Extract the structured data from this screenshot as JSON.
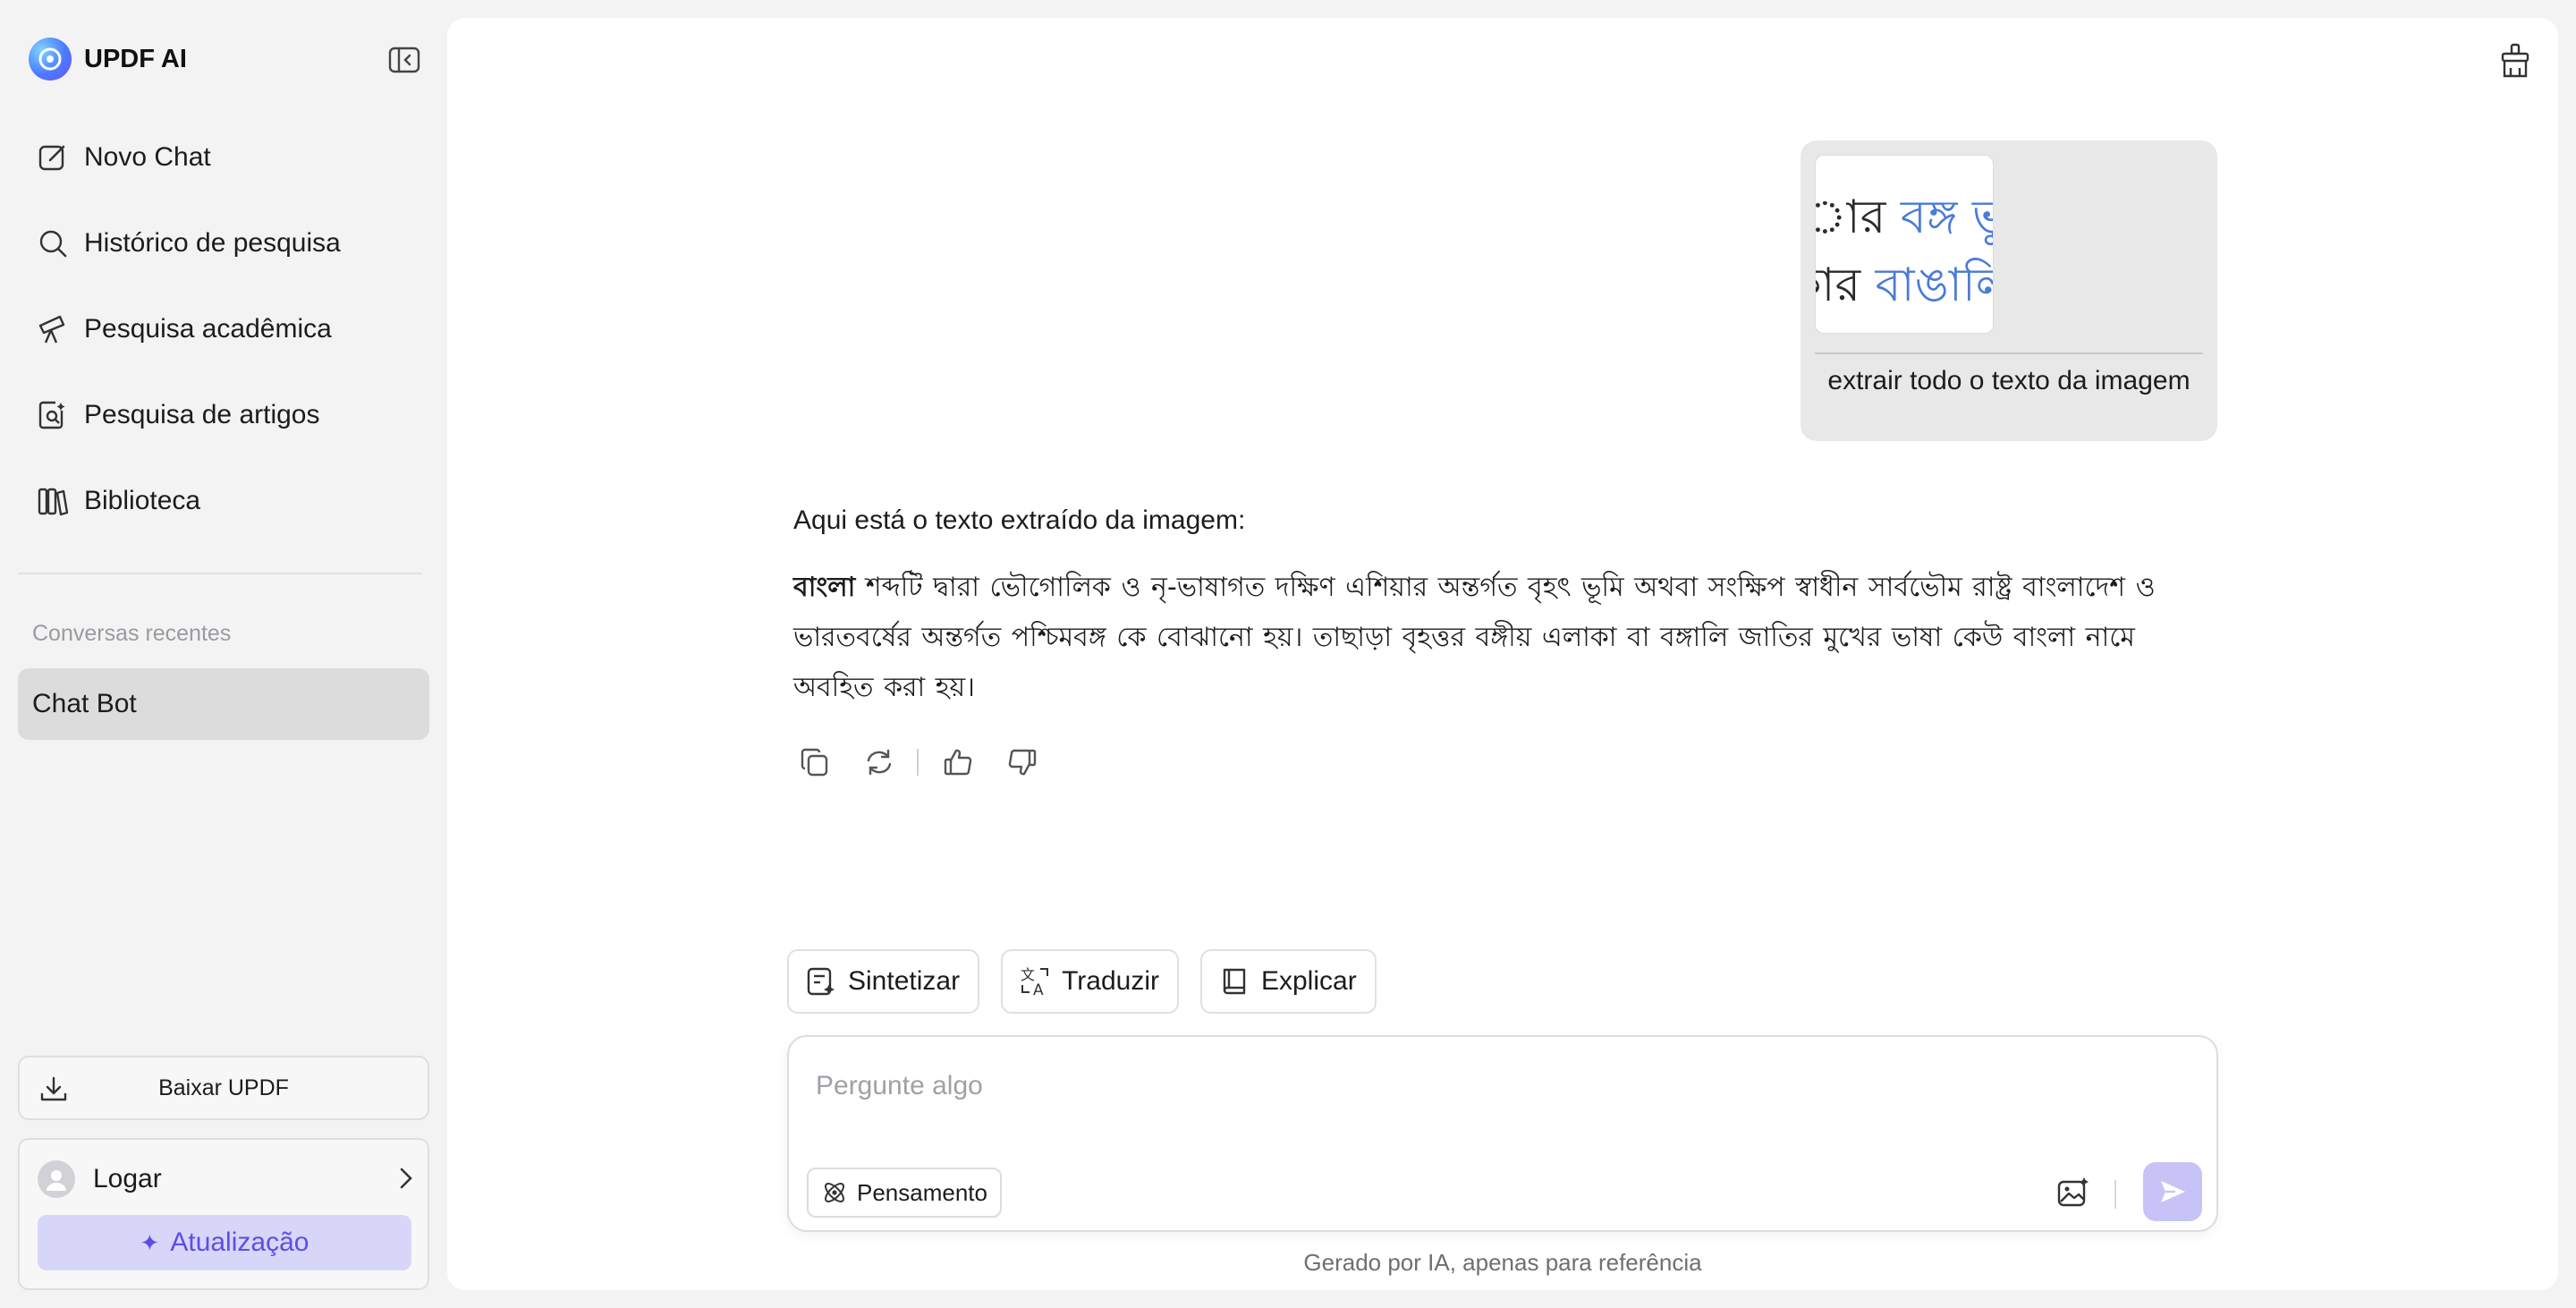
{
  "brand": {
    "name": "UPDF AI",
    "logo_icon": "updf-logo-icon"
  },
  "sidebar": {
    "collapse_icon": "sidebar-collapse-icon",
    "items": [
      {
        "label": "Novo Chat",
        "icon": "edit-icon"
      },
      {
        "label": "Histórico de pesquisa",
        "icon": "search-icon"
      },
      {
        "label": "Pesquisa acadêmica",
        "icon": "telescope-icon"
      },
      {
        "label": "Pesquisa de artigos",
        "icon": "doc-search-icon"
      },
      {
        "label": "Biblioteca",
        "icon": "library-icon"
      }
    ],
    "recent_title": "Conversas recentes",
    "recent_items": [
      {
        "label": "Chat Bot",
        "active": true
      }
    ],
    "download_label": "Baixar UPDF",
    "login_label": "Logar",
    "upgrade_label": "Atualização"
  },
  "chat": {
    "user_message": {
      "image_text_line1_a": "ার ",
      "image_text_line1_b": "বঙ্গ ভূমি",
      "image_text_line2_a": "কার ",
      "image_text_line2_b": "বাঙালি",
      "text": "extrair todo o texto da imagem"
    },
    "answer": {
      "intro": "Aqui está o texto extraído da imagem:",
      "bold_word": "বাংলা",
      "body": " শব্দটি দ্বারা ভৌগোলিক ও নৃ-ভাষাগত দক্ষিণ এশিয়ার অন্তর্গত বৃহৎ ভূমি অথবা সংক্ষিপ স্বাধীন সার্বভৌম রাষ্ট্র বাংলাদেশ ও ভারতবর্ষের অন্তর্গত পশ্চিমবঙ্গ কে বোঝানো হয়। তাছাড়া বৃহত্তর বঙ্গীয় এলাকা বা বঙ্গালি জাতির মুখের ভাষা কেউ বাংলা নামে অবহিত করা হয়।"
    },
    "actions": [
      "copy-icon",
      "regenerate-icon",
      "thumbs-up-icon",
      "thumbs-down-icon"
    ]
  },
  "quick_actions": [
    {
      "label": "Sintetizar",
      "icon": "summarize-icon"
    },
    {
      "label": "Traduzir",
      "icon": "translate-icon"
    },
    {
      "label": "Explicar",
      "icon": "book-icon"
    }
  ],
  "composer": {
    "placeholder": "Pergunte algo",
    "value": "",
    "thinking_label": "Pensamento"
  },
  "disclaimer": "Gerado por IA, apenas para referência",
  "colors": {
    "accent": "#5b4ee6",
    "upgrade_bg": "#d8d6f8",
    "send_bg": "#c8c3f7",
    "image_blue": "#4a7bd6"
  }
}
